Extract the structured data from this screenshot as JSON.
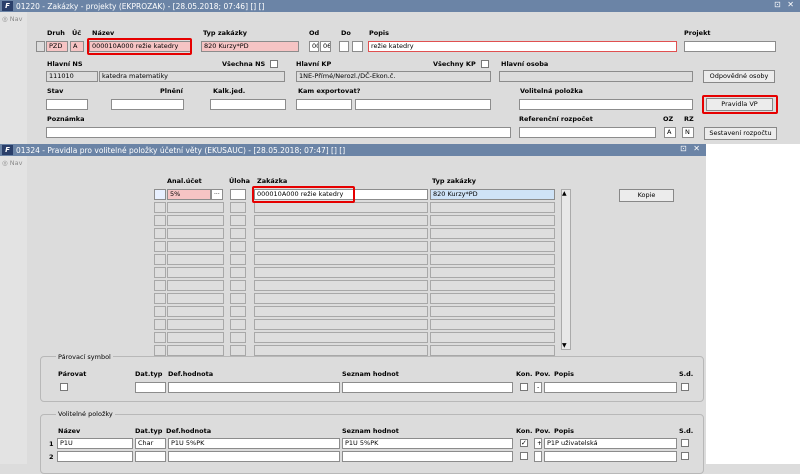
{
  "win1": {
    "title": "01220 - Zakázky - projekty (EKPROZAK) - [28.05.2018; 07:46] [] []",
    "controls": "⊡ ✕",
    "nav": "Nav",
    "labels": {
      "druh": "Druh",
      "uc": "Úč",
      "nazev": "Název",
      "typ": "Typ zakázky",
      "od": "Od",
      "do": "Do",
      "popis": "Popis",
      "projekt": "Projekt",
      "hlavni_ns": "Hlavní NS",
      "vsechna_ns": "Všechna NS",
      "hlavni_kp": "Hlavní KP",
      "vsechny_kp": "Všechny KP",
      "hlavni_osoba": "Hlavní osoba",
      "stav": "Stav",
      "plneni": "Plnění",
      "kalk": "Kalk.jed.",
      "kam": "Kam exportovat?",
      "volitelna": "Volitelná položka",
      "poznamka": "Poznámka",
      "ref": "Referenční rozpočet",
      "oz": "OZ",
      "rz": "RZ"
    },
    "values": {
      "druh": "PZD",
      "uc": "A",
      "nazev": "000010A000 režie katedry",
      "typ": "820 Kurzy*PD",
      "od": "00",
      "do": "06",
      "popis": "režie katedry",
      "hlavni_ns": "111010",
      "ns_name": "katedra matematiky",
      "hlavni_kp": "1NE-Přímé/Nerozl./DČ-Ekon.č.",
      "oz": "A",
      "rz": "N"
    },
    "buttons": {
      "odpovedne": "Odpovědné osoby",
      "pravidla": "Pravidla VP",
      "sestaveni": "Sestavení rozpočtu"
    }
  },
  "win2": {
    "title": "01324 - Pravidla pro volitelné položky účetní věty (EKUSAUC) - [28.05.2018; 07:47] [] []",
    "controls": "⊡ ✕",
    "nav": "Nav",
    "headers": {
      "anal": "Anal.účet",
      "uloha": "Úloha",
      "zakazka": "Zakázka",
      "typ": "Typ zakázky"
    },
    "row1": {
      "anal": "5%",
      "ellipsis": "...",
      "zakazka": "000010A000 režie katedry",
      "typ": "820 Kurzy*PD"
    },
    "kopie": "Kopie",
    "parovaci": {
      "title": "Párovací symbol",
      "parovat": "Párovat",
      "dattyp": "Dat.typ",
      "defh": "Def.hodnota",
      "seznam": "Seznam hodnot",
      "kon": "Kon.",
      "pov": "Pov.",
      "popis": "Popis",
      "sd": "S.d.",
      "pov_value": "-"
    },
    "volitelne": {
      "title": "Volitelné položky",
      "nazev": "Název",
      "dattyp": "Dat.typ",
      "defh": "Def.hodnota",
      "seznam": "Seznam hodnot",
      "kon": "Kon.",
      "pov": "Pov.",
      "popis": "Popis",
      "sd": "S.d.",
      "rows": [
        {
          "num": "1",
          "nazev": "P1U",
          "dattyp": "Char",
          "defh": "P1U 5%PK",
          "seznam": "P1U 5%PK",
          "kon": "✓",
          "pov": "+",
          "popis": "P1P uživatelská"
        },
        {
          "num": "2",
          "nazev": "",
          "dattyp": "",
          "defh": "",
          "seznam": "",
          "kon": "",
          "pov": "",
          "popis": ""
        }
      ]
    }
  }
}
